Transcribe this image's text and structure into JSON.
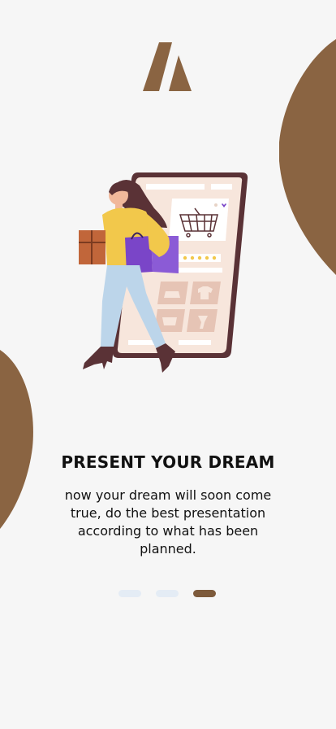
{
  "onboarding": {
    "title": "PRESENT YOUR DREAM",
    "description": "now your dream will soon come true, do the best presentation according to what has been planned."
  },
  "pagination": {
    "total": 3,
    "active_index": 2,
    "inactive_color": "#e4ecf5",
    "active_color": "#7d5a3b"
  },
  "colors": {
    "background": "#f6f6f6",
    "brand_brown": "#8a6442",
    "phone_frame": "#5a3236",
    "phone_screen": "#f7e6dc",
    "accent_purple": "#7a45c8",
    "sweater_yellow": "#f2c84b",
    "jeans_blue": "#bcd5ea"
  },
  "icons": {
    "logo": "brand-logo",
    "illustration": "shopping-woman-phone-illustration"
  }
}
